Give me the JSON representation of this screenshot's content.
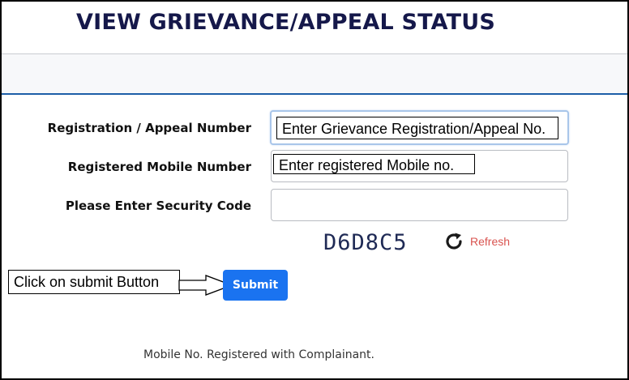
{
  "page": {
    "title": "VIEW GRIEVANCE/APPEAL STATUS"
  },
  "form": {
    "registration_label": "Registration / Appeal Number",
    "mobile_label": "Registered Mobile Number",
    "security_label": "Please Enter Security Code",
    "registration_placeholder_callout": "Enter Grievance Registration/Appeal No.",
    "mobile_placeholder_callout": "Enter registered Mobile no.",
    "captcha_code": "D6D8C5",
    "refresh_label": "Refresh",
    "submit_label": "Submit"
  },
  "annotation": {
    "submit_callout": "Click on submit Button"
  },
  "footer": {
    "note": "Mobile No. Registered with Complainant."
  },
  "colors": {
    "title": "#15184a",
    "accent_rule": "#1d5fa8",
    "submit_bg": "#1a73f0",
    "refresh_text": "#d9534f",
    "captcha": "#1f2a55"
  },
  "icons": {
    "refresh": "refresh-icon",
    "arrow": "arrow-right-icon"
  }
}
